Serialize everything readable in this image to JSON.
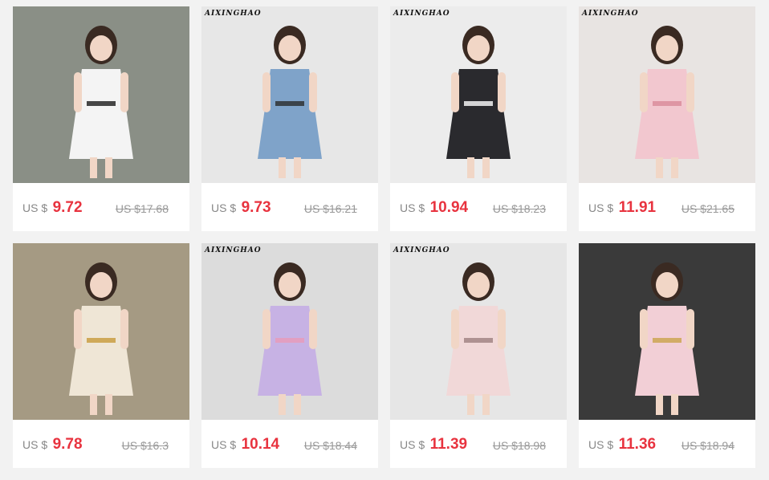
{
  "products": [
    {
      "brand": "",
      "currency": "US $",
      "price": "9.72",
      "old_price": "US $17.68",
      "photo": "girl-white-ruffle-top-black-shorts",
      "bg": "#8a8f86",
      "outfit": "#f4f4f4",
      "accent": "#1a1a1a"
    },
    {
      "brand": "AIXINGHAO",
      "currency": "US $",
      "price": "9.73",
      "old_price": "US $16.21",
      "photo": "girl-denim-dress",
      "bg": "#e7e7e7",
      "outfit": "#7fa3c9",
      "accent": "#2b2b2b"
    },
    {
      "brand": "AIXINGHAO",
      "currency": "US $",
      "price": "10.94",
      "old_price": "US $18.23",
      "photo": "black-jeans-white-sneakers",
      "bg": "#ececec",
      "outfit": "#2a2a2e",
      "accent": "#ffffff"
    },
    {
      "brand": "AIXINGHAO",
      "currency": "US $",
      "price": "11.91",
      "old_price": "US $21.65",
      "photo": "girl-pink-floral-chiffon-dress",
      "bg": "#e8e4e2",
      "outfit": "#f2c7cf",
      "accent": "#d88a98"
    },
    {
      "brand": "",
      "currency": "US $",
      "price": "9.78",
      "old_price": "US $16.3",
      "photo": "girl-striped-jumpsuit-straw-hat",
      "bg": "#a59a83",
      "outfit": "#efe6d6",
      "accent": "#c79a3a"
    },
    {
      "brand": "AIXINGHAO",
      "currency": "US $",
      "price": "10.14",
      "old_price": "US $18.44",
      "photo": "girl-lavender-tutu-dress-pink-flowers",
      "bg": "#dcdcdc",
      "outfit": "#c7b2e4",
      "accent": "#e89ab8"
    },
    {
      "brand": "AIXINGHAO",
      "currency": "US $",
      "price": "11.39",
      "old_price": "US $18.98",
      "photo": "girl-pink-tulle-dress-sunhat",
      "bg": "#e6e6e6",
      "outfit": "#f1d8d8",
      "accent": "#9d7f7f"
    },
    {
      "brand": "",
      "currency": "US $",
      "price": "11.36",
      "old_price": "US $18.94",
      "photo": "girl-pink-lace-dress-iron-gate",
      "bg": "#3a3a3a",
      "outfit": "#f2cfd6",
      "accent": "#c9a24a"
    }
  ]
}
